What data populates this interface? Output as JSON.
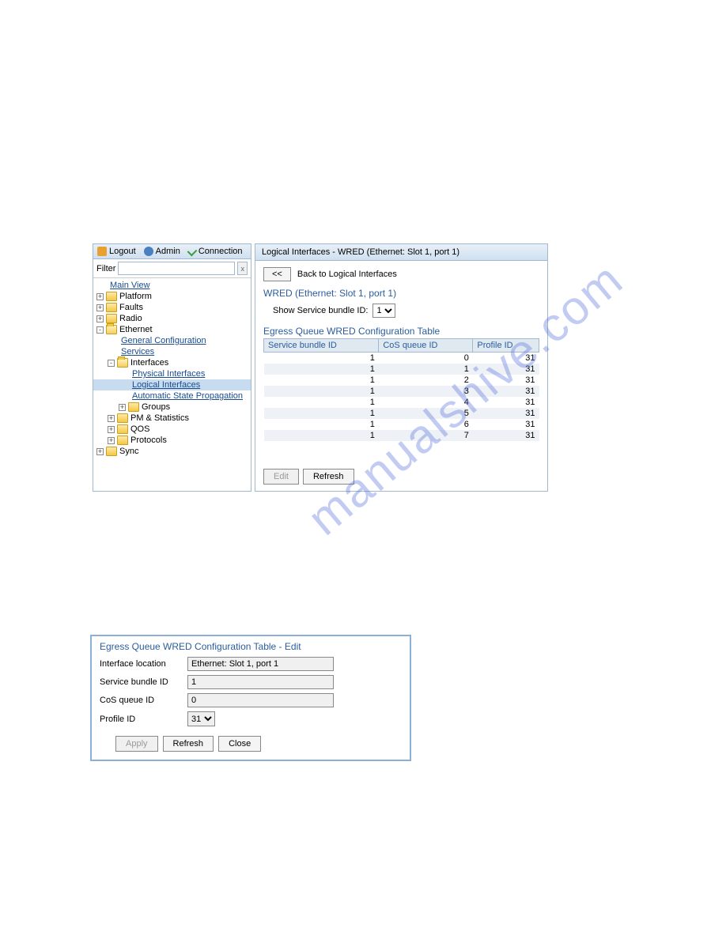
{
  "topbar": {
    "logout": "Logout",
    "admin": "Admin",
    "connection": "Connection"
  },
  "filter": {
    "label": "Filter",
    "value": "",
    "clear": "x"
  },
  "tree": {
    "mainview": "Main View",
    "platform": "Platform",
    "faults": "Faults",
    "radio": "Radio",
    "ethernet": "Ethernet",
    "general_config": "General Configuration",
    "services": "Services",
    "interfaces": "Interfaces",
    "physical_interfaces": "Physical Interfaces",
    "logical_interfaces": "Logical Interfaces",
    "auto_state_prop": "Automatic State Propagation",
    "groups": "Groups",
    "pm_stats": "PM & Statistics",
    "qos": "QOS",
    "protocols": "Protocols",
    "sync": "Sync"
  },
  "main": {
    "header": "Logical Interfaces - WRED (Ethernet: Slot 1, port 1)",
    "back_btn": "<<",
    "back_label": "Back to Logical Interfaces",
    "wred_title": "WRED (Ethernet: Slot 1, port 1)",
    "show_label": "Show Service bundle ID:",
    "show_value": "1",
    "table_title": "Egress Queue WRED Configuration Table",
    "col1": "Service bundle ID",
    "col2": "CoS queue ID",
    "col3": "Profile ID",
    "rows": [
      {
        "sbid": "1",
        "cos": "0",
        "pid": "31"
      },
      {
        "sbid": "1",
        "cos": "1",
        "pid": "31"
      },
      {
        "sbid": "1",
        "cos": "2",
        "pid": "31"
      },
      {
        "sbid": "1",
        "cos": "3",
        "pid": "31"
      },
      {
        "sbid": "1",
        "cos": "4",
        "pid": "31"
      },
      {
        "sbid": "1",
        "cos": "5",
        "pid": "31"
      },
      {
        "sbid": "1",
        "cos": "6",
        "pid": "31"
      },
      {
        "sbid": "1",
        "cos": "7",
        "pid": "31"
      }
    ],
    "edit_btn": "Edit",
    "refresh_btn": "Refresh"
  },
  "dialog": {
    "title": "Egress Queue WRED Configuration Table - Edit",
    "interface_loc_label": "Interface location",
    "interface_loc_value": "Ethernet: Slot 1, port 1",
    "sbid_label": "Service bundle ID",
    "sbid_value": "1",
    "cos_label": "CoS queue ID",
    "cos_value": "0",
    "profile_label": "Profile ID",
    "profile_value": "31",
    "apply": "Apply",
    "refresh": "Refresh",
    "close": "Close"
  },
  "watermark": "manualshive.com"
}
